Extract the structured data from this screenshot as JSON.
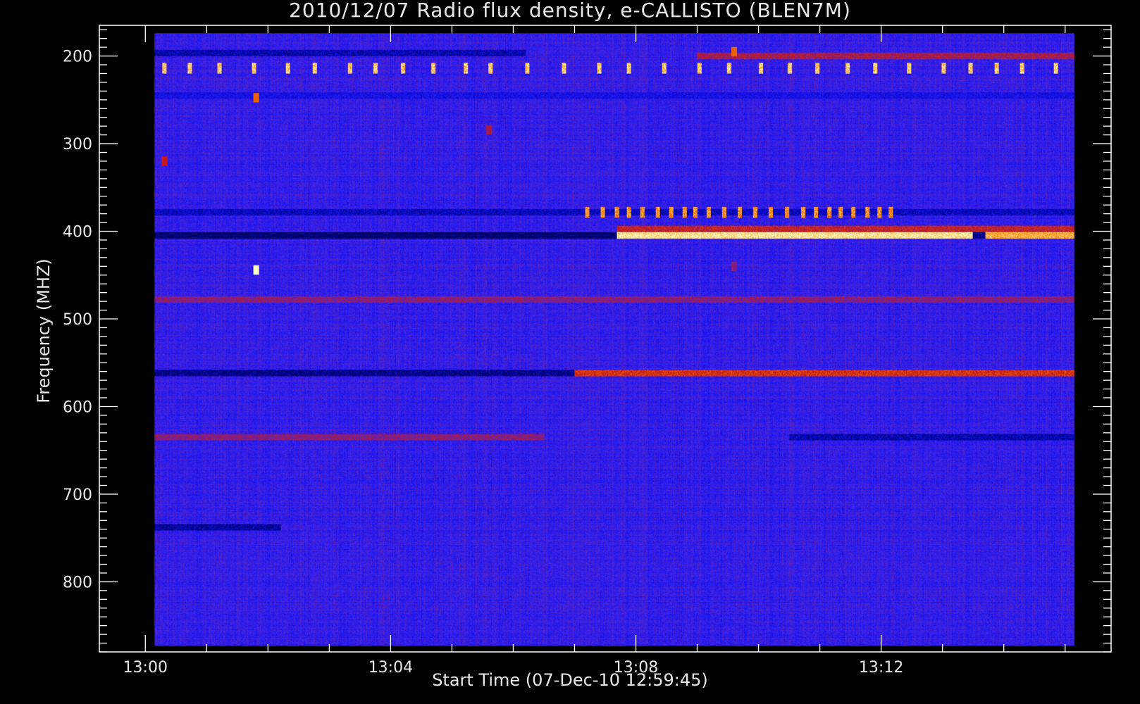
{
  "title": "2010/12/07  Radio flux density, e-CALLISTO (BLEN7M)",
  "xlabel": "Start Time (07-Dec-10 12:59:45)",
  "ylabel": "Frequency (MHZ)",
  "colors": {
    "background": "#000000",
    "axis": "#ffffff",
    "colormap": [
      "#000060",
      "#1010f0",
      "#3c24e8",
      "#c81818",
      "#ff8800",
      "#ffffc8"
    ]
  },
  "chart_data": {
    "type": "heatmap",
    "title": "2010/12/07  Radio flux density, e-CALLISTO (BLEN7M)",
    "xlabel": "Start Time (07-Dec-10 12:59:45)",
    "ylabel": "Frequency (MHZ)",
    "x_unit": "minutes after 13:00",
    "y_unit": "MHz",
    "xlim": [
      -0.75,
      15.75
    ],
    "ylim": [
      880,
      165
    ],
    "data_x_range": [
      0.15,
      15.15
    ],
    "data_y_range": [
      174,
      873
    ],
    "x_ticks": [
      {
        "value": 0,
        "label": "13:00"
      },
      {
        "value": 4,
        "label": "13:04"
      },
      {
        "value": 8,
        "label": "13:08"
      },
      {
        "value": 12,
        "label": "13:12"
      }
    ],
    "y_ticks": [
      {
        "value": 200,
        "label": "200"
      },
      {
        "value": 300,
        "label": "300"
      },
      {
        "value": 400,
        "label": "400"
      },
      {
        "value": 500,
        "label": "500"
      },
      {
        "value": 600,
        "label": "600"
      },
      {
        "value": 700,
        "label": "700"
      },
      {
        "value": 800,
        "label": "800"
      }
    ],
    "background_level": 0.3,
    "features": [
      {
        "kind": "band",
        "freq": 405,
        "t_start": 0.15,
        "t_end": 7.7,
        "level": 0.0
      },
      {
        "kind": "band",
        "freq": 405,
        "t_start": 7.7,
        "t_end": 13.5,
        "level": 0.95
      },
      {
        "kind": "band",
        "freq": 405,
        "t_start": 13.5,
        "t_end": 13.7,
        "level": 0.05
      },
      {
        "kind": "band",
        "freq": 405,
        "t_start": 13.7,
        "t_end": 15.15,
        "level": 0.85
      },
      {
        "kind": "band",
        "freq": 397,
        "t_start": 7.7,
        "t_end": 15.15,
        "level": 0.55
      },
      {
        "kind": "band",
        "freq": 378,
        "t_start": 0.15,
        "t_end": 15.15,
        "level": 0.12
      },
      {
        "kind": "band",
        "freq": 562,
        "t_start": 0.15,
        "t_end": 7.0,
        "level": 0.05
      },
      {
        "kind": "band",
        "freq": 562,
        "t_start": 7.0,
        "t_end": 15.15,
        "level": 0.6
      },
      {
        "kind": "band",
        "freq": 478,
        "t_start": 0.15,
        "t_end": 15.15,
        "level": 0.45
      },
      {
        "kind": "band",
        "freq": 635,
        "t_start": 0.15,
        "t_end": 6.5,
        "level": 0.45
      },
      {
        "kind": "band",
        "freq": 635,
        "t_start": 10.5,
        "t_end": 15.15,
        "level": 0.1
      },
      {
        "kind": "band",
        "freq": 738,
        "t_start": 0.15,
        "t_end": 2.2,
        "level": 0.08
      },
      {
        "kind": "band",
        "freq": 197,
        "t_start": 0.15,
        "t_end": 6.2,
        "level": 0.1
      },
      {
        "kind": "band",
        "freq": 245,
        "t_start": 0.15,
        "t_end": 15.15,
        "level": 0.2
      },
      {
        "kind": "band",
        "freq": 200,
        "t_start": 9.0,
        "t_end": 15.15,
        "level": 0.5
      },
      {
        "kind": "pulses",
        "freq": 214,
        "t_start": 0.3,
        "t_end": 15.15,
        "spacing": 0.5,
        "level": 0.85
      },
      {
        "kind": "pulses",
        "freq": 378,
        "t_start": 7.2,
        "t_end": 12.3,
        "spacing": 0.22,
        "level": 0.75
      },
      {
        "kind": "spot",
        "freq": 444,
        "time": 1.8,
        "level": 1.0
      },
      {
        "kind": "spot",
        "freq": 248,
        "time": 1.8,
        "level": 0.7
      },
      {
        "kind": "spot",
        "freq": 320,
        "time": 0.3,
        "level": 0.55
      },
      {
        "kind": "spot",
        "freq": 285,
        "time": 5.6,
        "level": 0.5
      },
      {
        "kind": "spot",
        "freq": 440,
        "time": 9.6,
        "level": 0.45
      },
      {
        "kind": "spot",
        "freq": 195,
        "time": 9.6,
        "level": 0.7
      }
    ]
  }
}
